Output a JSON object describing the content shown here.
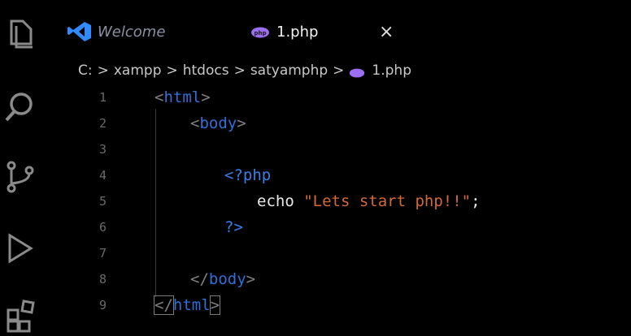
{
  "tabs": [
    {
      "label": "Welcome",
      "icon": "vscode-logo-icon",
      "active": false
    },
    {
      "label": "1.php",
      "icon": "php-file-icon",
      "active": true
    }
  ],
  "tab_close_glyph": "×",
  "breadcrumb": {
    "items": [
      "C:",
      "xampp",
      "htdocs",
      "satyamphp",
      "1.php"
    ],
    "separator": ">"
  },
  "editor": {
    "lines": [
      {
        "num": "1"
      },
      {
        "num": "2"
      },
      {
        "num": "3"
      },
      {
        "num": "4"
      },
      {
        "num": "5"
      },
      {
        "num": "6"
      },
      {
        "num": "7"
      },
      {
        "num": "8"
      },
      {
        "num": "9"
      }
    ],
    "tokens": {
      "lt": "<",
      "gt": ">",
      "lt_slash": "</",
      "html": "html",
      "body": "body",
      "php_open": "<?php",
      "echo": "echo",
      "string": "\"Lets start php!!\"",
      "semicolon": ";",
      "php_close": "?>"
    }
  },
  "colors": {
    "accent_blue": "#2f6fd6",
    "string_orange": "#d4683a",
    "php_icon_purple": "#9b6ef3",
    "vscode_blue": "#2f8bff"
  },
  "activity_bar": [
    "explorer-icon",
    "search-icon",
    "source-control-icon",
    "run-debug-icon",
    "extensions-icon"
  ]
}
